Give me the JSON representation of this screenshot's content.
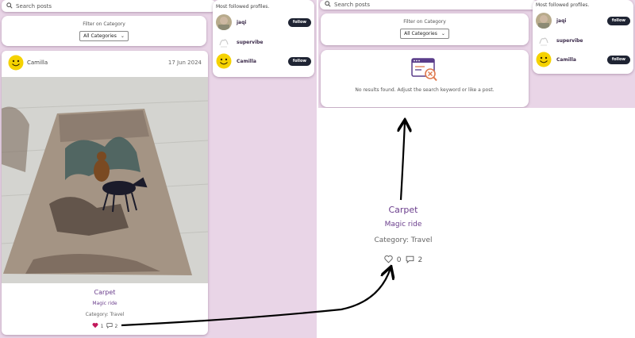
{
  "search": {
    "placeholder": "Search posts"
  },
  "filter": {
    "label": "Filter on Category",
    "selected": "All Categories"
  },
  "profiles": {
    "title": "Most followed profiles.",
    "items": [
      {
        "name": "jaqi",
        "follow_label": "follow",
        "has_follow": true
      },
      {
        "name": "supervibe",
        "follow_label": "",
        "has_follow": false
      },
      {
        "name": "Camilla",
        "follow_label": "follow",
        "has_follow": true
      }
    ]
  },
  "post": {
    "author": "Camilla",
    "date": "17 Jun 2024",
    "title": "Carpet",
    "subtitle": "Magic ride",
    "category": "Category: Travel",
    "likes": "1",
    "comments": "2"
  },
  "no_results": {
    "message": "No results found. Adjust the search keyword or like a post."
  },
  "zoom": {
    "title": "Carpet",
    "subtitle": "Magic ride",
    "category": "Category: Travel",
    "likes": "0",
    "comments": "2"
  },
  "colors": {
    "background": "#e9d5e7",
    "accent": "#6a3d8c",
    "heart_filled": "#c2185b",
    "button_dark": "#1f2433"
  }
}
